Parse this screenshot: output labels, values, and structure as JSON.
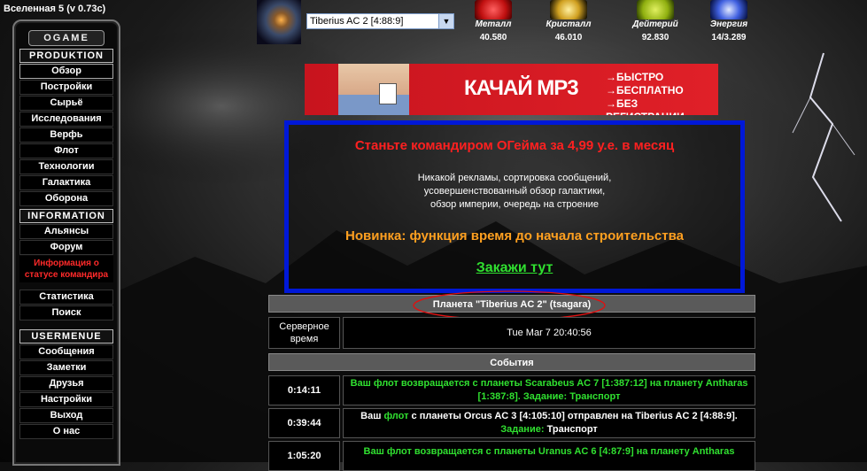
{
  "version_label": "Вселенная 5 (v 0.73c)",
  "menu": {
    "logo": "OGAME",
    "sections": {
      "production": "PRODUKTION",
      "information": "INFORMATION",
      "usermenue": "USERMENUE"
    },
    "production_items": [
      "Обзор",
      "Постройки",
      "Сырьё",
      "Исследования",
      "Верфь",
      "Флот",
      "Технологии",
      "Галактика",
      "Оборона"
    ],
    "information_items": [
      "Альянсы",
      "Форум"
    ],
    "commander_info": "Информация о статусе командира",
    "information_items2": [
      "Статистика",
      "Поиск"
    ],
    "user_items": [
      "Сообщения",
      "Заметки",
      "Друзья",
      "Настройки",
      "Выход",
      "О нас"
    ]
  },
  "planet_select": {
    "selected": "Tiberius AC 2 [4:88:9]"
  },
  "resources": [
    {
      "name": "Металл",
      "value": "40.580",
      "icon": "metal-icon",
      "color": "#d82020"
    },
    {
      "name": "Кристалл",
      "value": "46.010",
      "icon": "crystal-icon",
      "color": "#e0c040"
    },
    {
      "name": "Дейтерий",
      "value": "92.830",
      "icon": "deuterium-icon",
      "color": "#a0c020"
    },
    {
      "name": "Энергия",
      "value": "14/3.289",
      "icon": "energy-icon",
      "color": "#4060e0"
    }
  ],
  "banner": {
    "title": "КАЧАЙ MP3",
    "bullets": [
      "→БЫСТРО",
      "→БЕСПЛАТНО",
      "→БЕЗ РЕГИСТРАЦИИ"
    ]
  },
  "promo": {
    "headline": "Станьте командиром ОГейма за 4,99 у.е. в месяц",
    "body": [
      "Никакой рекламы, сортировка сообщений,",
      "усовершенствованный обзор галактики,",
      "обзор империи, очередь на строение"
    ],
    "news": "Новинка: функция время до начала строительства",
    "link": "Закажи тут"
  },
  "overview": {
    "planet_header": "Планета \"Tiberius AC 2\" (tsagara)",
    "server_time_label": "Серверное время",
    "server_time_value": "Tue Mar 7 20:40:56",
    "events_header": "События",
    "events": [
      {
        "time": "0:14:11",
        "a": "Ваш флот возвращается с планеты Scarabeus AC 7 [1:387:12] на планету Antharas [1:387:8]. Задание: Транспорт"
      },
      {
        "time": "0:39:44",
        "a": "Ваш",
        "b": "флот",
        "c": "с планеты Orcus AC 3 [4:105:10] отправлен на Tiberius AC 2 [4:88:9].",
        "d": "Задание:",
        "e": "Транспорт"
      },
      {
        "time": "1:05:20",
        "a": "Ваш флот возвращается с планеты Uranus AC 6 [4:87:9] на планету Antharas"
      }
    ]
  },
  "colors": {
    "promo_border": "#0018d8",
    "promo_headline": "#ff2020",
    "promo_news": "#ffa020",
    "fleet_green": "#30e030"
  }
}
